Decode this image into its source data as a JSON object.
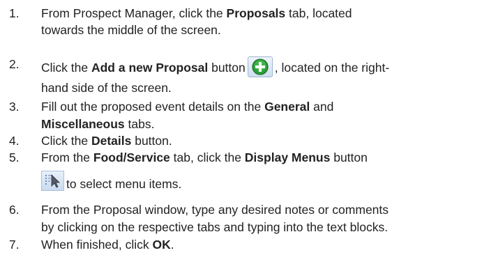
{
  "steps": [
    {
      "num": "1.",
      "line1_pre": "From Prospect Manager, click the ",
      "line1_bold": "Proposals",
      "line1_post": " tab, located",
      "line2": "towards the middle of the screen."
    },
    {
      "num": "2.",
      "line1_pre": "Click the ",
      "line1_bold": "Add a new Proposal",
      "line1_mid": " button",
      "line1_post": ", located on the right-",
      "line2": "hand side of the screen.",
      "icon": "add-green-plus-icon"
    },
    {
      "num": "3.",
      "line1_pre": "Fill out the proposed event details on the ",
      "line1_bold": "General",
      "line1_post": " and",
      "line2_bold": "Miscellaneous",
      "line2_post": " tabs."
    },
    {
      "num": "4.",
      "line1_pre": "Click the ",
      "line1_bold": "Details",
      "line1_post": " button."
    },
    {
      "num": "5.",
      "line1_pre": "From the ",
      "line1_bold": "Food/Service",
      "line1_mid": " tab, click the ",
      "line1_bold2": "Display Menus",
      "line1_post": " button",
      "line2": "to select menu items.",
      "icon": "display-menus-cursor-icon"
    },
    {
      "num": "6.",
      "line1": "From the Proposal window, type any desired notes or comments",
      "line2": "by clicking on the respective tabs and typing into the text blocks."
    },
    {
      "num": "7.",
      "line1_pre": "When finished, click ",
      "line1_bold": "OK",
      "line1_post": "."
    }
  ]
}
